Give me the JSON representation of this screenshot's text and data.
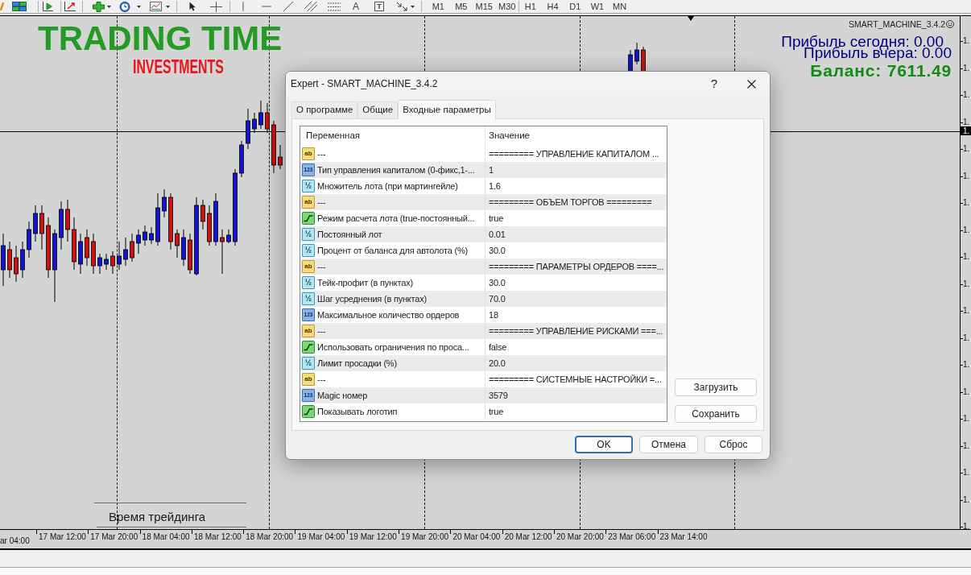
{
  "toolbar": {
    "text_tool": "A",
    "label_tool": "T",
    "timeframes": [
      "M1",
      "M5",
      "M15",
      "M30",
      "H1",
      "H4",
      "D1",
      "W1",
      "MN"
    ]
  },
  "chart": {
    "logo": {
      "title": "TRADING TIME",
      "subtitle": "INVESTMENTS"
    },
    "expert_label": "SMART_MACHINE_3.4.2",
    "info": [
      {
        "kind": "profit",
        "text": "Прибыль сегодня: 0.00"
      },
      {
        "kind": "profit",
        "text": "Прибыль вчера: 0.00"
      },
      {
        "kind": "balance",
        "text": "Баланс: 7611.49"
      }
    ],
    "session_label": "Время трейдинга",
    "price_axis": {
      "labels": [
        "1.",
        "1.",
        "1.",
        "1.",
        "1.",
        "1.",
        "1.",
        "1.",
        "1.",
        "1.",
        "1.",
        "1.",
        "1.",
        "1.",
        "1.",
        "1.",
        "1.",
        "1.",
        "1."
      ],
      "current": "1."
    },
    "time_axis": [
      "ar 04:00",
      "17 Mar 12:00",
      "17 Mar 20:00",
      "18 Mar 04:00",
      "18 Mar 12:00",
      "18 Mar 20:00",
      "19 Mar 04:00",
      "19 Mar 12:00",
      "19 Mar 20:00",
      "20 Mar 04:00",
      "20 Mar 12:00",
      "20 Mar 20:00",
      "23 Mar 06:00",
      "23 Mar 14:00"
    ]
  },
  "dialog": {
    "title": "Expert - SMART_MACHINE_3.4.2",
    "help": "?",
    "tabs": [
      {
        "label": "О программе",
        "selected": false
      },
      {
        "label": "Общие",
        "selected": false
      },
      {
        "label": "Входные параметры",
        "selected": true
      }
    ],
    "table": {
      "columns": [
        "Переменная",
        "Значение"
      ],
      "rows": [
        {
          "kind": "string",
          "type_label": "ab",
          "variable": "---",
          "value": "========= УПРАВЛЕНИЕ КАПИТАЛОМ ..."
        },
        {
          "kind": "int",
          "type_label": "123",
          "variable": "Тип управления капиталом (0-фикс,1-...",
          "value": "1"
        },
        {
          "kind": "double",
          "type_label": "½",
          "variable": "Множитель лота (при мартингейле)",
          "value": "1.6"
        },
        {
          "kind": "string",
          "type_label": "ab",
          "variable": "---",
          "value": "========= ОБЪЕМ ТОРГОВ ========="
        },
        {
          "kind": "bool",
          "variable": "Режим расчета лота (true-постоянный...",
          "value": "true"
        },
        {
          "kind": "double",
          "type_label": "½",
          "variable": "Постоянный лот",
          "value": "0.01"
        },
        {
          "kind": "double",
          "type_label": "½",
          "variable": "Процент от баланса для автолота (%)",
          "value": "30.0"
        },
        {
          "kind": "string",
          "type_label": "ab",
          "variable": "---",
          "value": "========= ПАРАМЕТРЫ ОРДЕРОВ ====..."
        },
        {
          "kind": "double",
          "type_label": "½",
          "variable": "Тейк-профит (в пунктах)",
          "value": "30.0"
        },
        {
          "kind": "double",
          "type_label": "½",
          "variable": "Шаг усреднения (в пунктах)",
          "value": "70.0"
        },
        {
          "kind": "int",
          "type_label": "123",
          "variable": "Максимальное количество ордеров",
          "value": "18"
        },
        {
          "kind": "string",
          "type_label": "ab",
          "variable": "---",
          "value": "========= УПРАВЛЕНИЕ РИСКАМИ ===..."
        },
        {
          "kind": "bool",
          "variable": "Использовать ограничения по проса...",
          "value": "false"
        },
        {
          "kind": "double",
          "type_label": "½",
          "variable": "Лимит просадки (%)",
          "value": "20.0"
        },
        {
          "kind": "string",
          "type_label": "ab",
          "variable": "---",
          "value": "========= СИСТЕМНЫЕ НАСТРОЙКИ =..."
        },
        {
          "kind": "int",
          "type_label": "123",
          "variable": "Magic номер",
          "value": "3579"
        },
        {
          "kind": "bool",
          "variable": "Показывать логотип",
          "value": "true"
        }
      ]
    },
    "side_buttons": [
      "Загрузить",
      "Сохранить"
    ],
    "buttons": [
      {
        "label": "OK",
        "default": true
      },
      {
        "label": "Отмена",
        "default": false
      },
      {
        "label": "Сброс",
        "default": false
      }
    ]
  }
}
